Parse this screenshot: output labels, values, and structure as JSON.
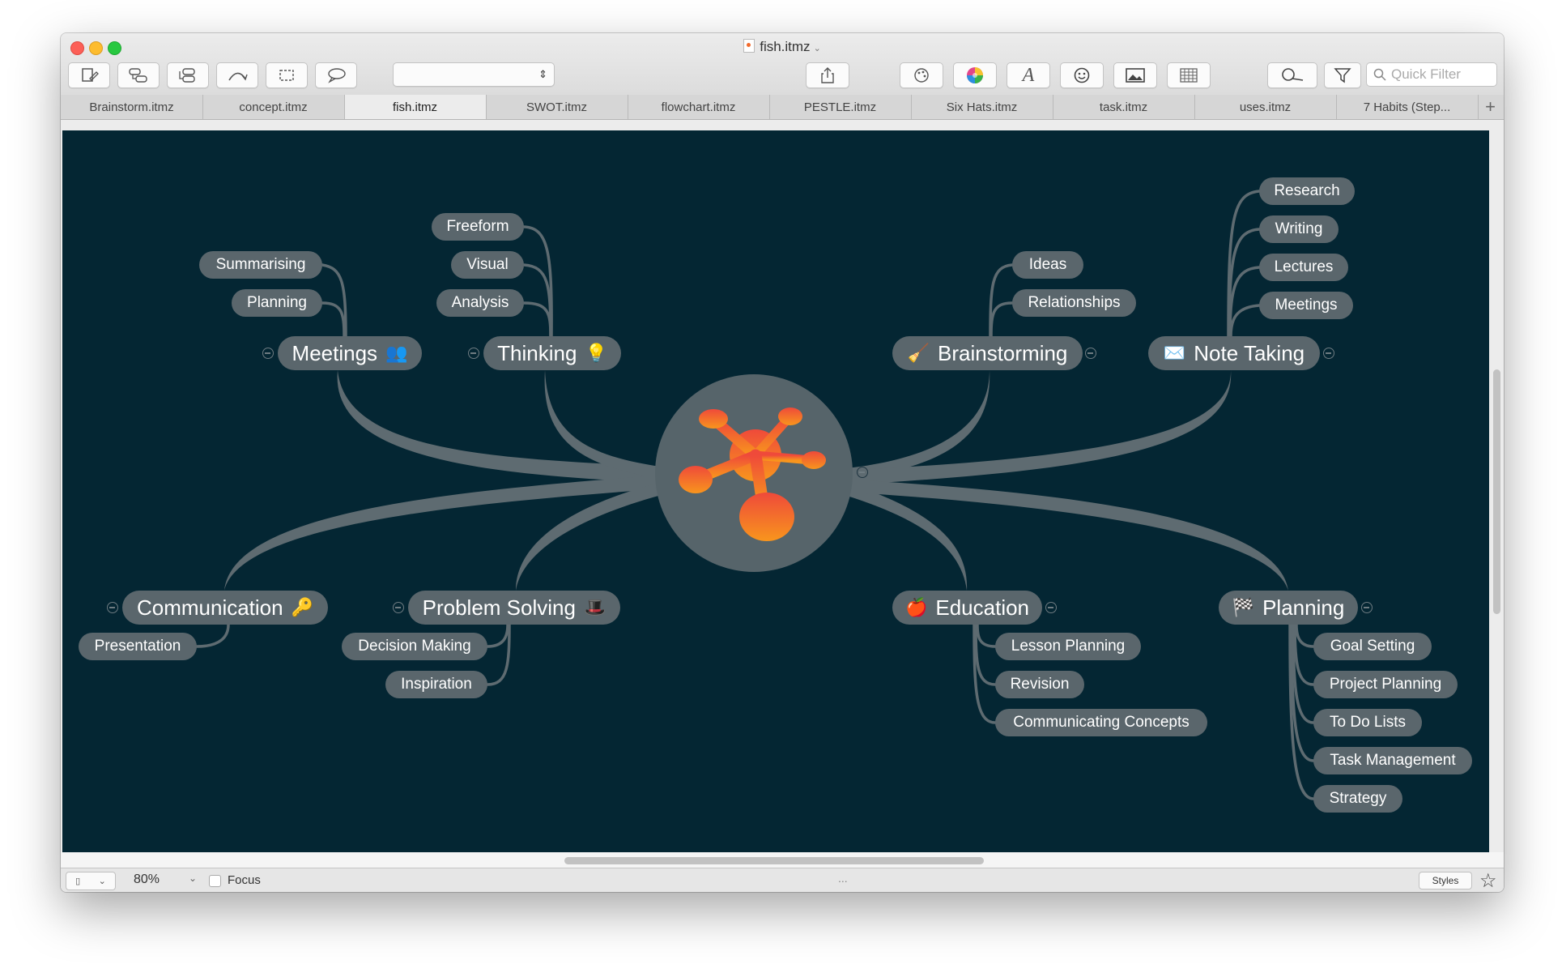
{
  "window": {
    "title": "fish.itmz"
  },
  "toolbar": {
    "search_placeholder": "Quick Filter"
  },
  "tabs": [
    "Brainstorm.itmz",
    "concept.itmz",
    "fish.itmz",
    "SWOT.itmz",
    "flowchart.itmz",
    "PESTLE.itmz",
    "Six Hats.itmz",
    "task.itmz",
    "uses.itmz",
    "7 Habits (Step..."
  ],
  "active_tab": 2,
  "mindmap": {
    "branches": {
      "meetings": {
        "label": "Meetings",
        "icon": "people-icon",
        "children": [
          "Summarising",
          "Planning"
        ]
      },
      "thinking": {
        "label": "Thinking",
        "icon": "lightbulb-icon",
        "children": [
          "Freeform",
          "Visual",
          "Analysis"
        ]
      },
      "brainstorming": {
        "label": "Brainstorming",
        "icon": "broom-icon",
        "children": [
          "Ideas",
          "Relationships"
        ]
      },
      "note_taking": {
        "label": "Note Taking",
        "icon": "envelope-icon",
        "children": [
          "Research",
          "Writing",
          "Lectures",
          "Meetings"
        ]
      },
      "communication": {
        "label": "Communication",
        "icon": "key-icon",
        "children": [
          "Presentation"
        ]
      },
      "problem_solving": {
        "label": "Problem Solving",
        "icon": "hat-icon",
        "children": [
          "Decision Making",
          "Inspiration"
        ]
      },
      "education": {
        "label": "Education",
        "icon": "apple-icon",
        "children": [
          "Lesson Planning",
          "Revision",
          "Communicating Concepts"
        ]
      },
      "planning": {
        "label": "Planning",
        "icon": "checkered-flag-icon",
        "children": [
          "Goal Setting",
          "Project Planning",
          "To Do Lists",
          "Task Management",
          "Strategy"
        ]
      }
    }
  },
  "colors": {
    "canvas": "#042633",
    "node": "#5a666c",
    "branch": "#5e6b71",
    "central_node": "#56646a",
    "logo_red": "#ef4a3a",
    "logo_orange": "#f8951d"
  },
  "statusbar": {
    "zoom": "80%",
    "focus_label": "Focus",
    "ellipsis": "...",
    "styles_label": "Styles"
  }
}
